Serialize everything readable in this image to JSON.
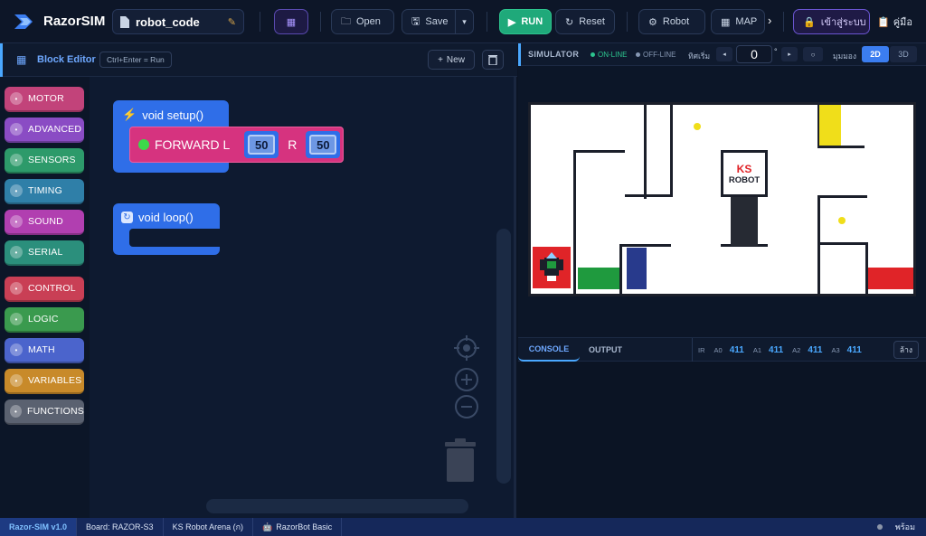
{
  "app": {
    "name": "RazorSIM",
    "file_name": "robot_code"
  },
  "toolbar": {
    "open_label": "Open",
    "save_label": "Save",
    "run_label": "RUN",
    "reset_label": "Reset",
    "robot_label": "Robot",
    "map_label": "MAP",
    "login_label": "เข้าสู่ระบบ",
    "manual_label": "คู่มือ"
  },
  "editor": {
    "title": "Block Editor",
    "shortcut": "Ctrl+Enter = Run",
    "new_label": "New"
  },
  "palette": [
    {
      "label": "MOTOR",
      "color": "#c2437a",
      "icon": "motor-icon"
    },
    {
      "label": "ADVANCED",
      "color": "#8a4cc4",
      "icon": "advanced-icon"
    },
    {
      "label": "SENSORS",
      "color": "#2d9a6a",
      "icon": "sensors-icon"
    },
    {
      "label": "TIMING",
      "color": "#2f7fa8",
      "icon": "timing-icon"
    },
    {
      "label": "SOUND",
      "color": "#b13fb0",
      "icon": "sound-icon"
    },
    {
      "label": "SERIAL",
      "color": "#2b8f7c",
      "icon": "serial-icon"
    },
    {
      "label": "CONTROL",
      "color": "#c93f55",
      "icon": "control-icon"
    },
    {
      "label": "LOGIC",
      "color": "#3a9a4e",
      "icon": "logic-icon"
    },
    {
      "label": "MATH",
      "color": "#4b64cc",
      "icon": "math-icon"
    },
    {
      "label": "VARIABLES",
      "color": "#c88a2a",
      "icon": "variables-icon"
    },
    {
      "label": "FUNCTIONS",
      "color": "#5a6170",
      "icon": "functions-icon"
    }
  ],
  "blocks": {
    "setup_label": "void setup()",
    "forward_label": "FORWARD L",
    "left_value": "50",
    "r_label": "R",
    "right_value": "50",
    "loop_label": "void loop()"
  },
  "simulator": {
    "title": "SIMULATOR",
    "online": "ON-LINE",
    "offline": "OFF-LINE",
    "direction_label": "ทิศเริ่ม",
    "angle_value": "0",
    "degree_symbol": "°",
    "view_label": "มุมมอง",
    "view_2d": "2D",
    "view_3d": "3D",
    "ks_text": "KS",
    "robot_text": "ROBOT"
  },
  "console": {
    "tab_console": "CONSOLE",
    "tab_output": "OUTPUT",
    "ir_label": "IR",
    "sensors": [
      {
        "name": "A0",
        "value": "411"
      },
      {
        "name": "A1",
        "value": "411"
      },
      {
        "name": "A2",
        "value": "411"
      },
      {
        "name": "A3",
        "value": "411"
      }
    ],
    "clear_label": "ล้าง"
  },
  "status": {
    "version": "Razor-SIM v1.0",
    "board": "Board: RAZOR-S3",
    "arena": "KS Robot Arena (ก)",
    "robot": "RazorBot Basic",
    "ready": "พร้อม"
  },
  "colors": {
    "accent": "#4aa8ff",
    "run": "#1fa97a",
    "block_blue": "#2f6ee8",
    "block_pink": "#d6337f"
  }
}
